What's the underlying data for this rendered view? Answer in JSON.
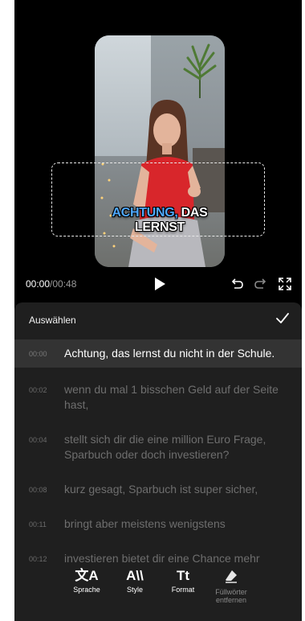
{
  "video": {
    "caption_highlight": "ACHTUNG,",
    "caption_rest": " DAS LERNST"
  },
  "player": {
    "current_time": "00:00",
    "separator": "/",
    "duration": "00:48"
  },
  "panel": {
    "title": "Auswählen",
    "rows": [
      {
        "time": "00:00",
        "text": "Achtung, das lernst du nicht in der Schule.",
        "selected": true
      },
      {
        "time": "00:02",
        "text": "wenn du mal 1 bisschen Geld auf der Seite hast,"
      },
      {
        "time": "00:04",
        "text": "stellt sich dir die eine million Euro Frage, Sparbuch oder doch investieren?"
      },
      {
        "time": "00:08",
        "text": "kurz gesagt, Sparbuch ist super sicher,"
      },
      {
        "time": "00:11",
        "text": "bringt aber meistens wenigstens"
      },
      {
        "time": "00:12",
        "text": "investieren bietet dir eine Chance mehr"
      }
    ]
  },
  "toolbar": {
    "sprache": {
      "icon": "文A",
      "label": "Sprache"
    },
    "style": {
      "icon": "A\\\\",
      "label": "Style"
    },
    "format": {
      "icon": "Tt",
      "label": "Format"
    },
    "fuellwoerter": {
      "label_line1": "Füllwörter",
      "label_line2": "entfernen"
    }
  },
  "colors": {
    "background": "#000000",
    "panel": "#1f1f1f",
    "selected_row": "#333333",
    "caption_highlight": "#4ea8ff"
  }
}
